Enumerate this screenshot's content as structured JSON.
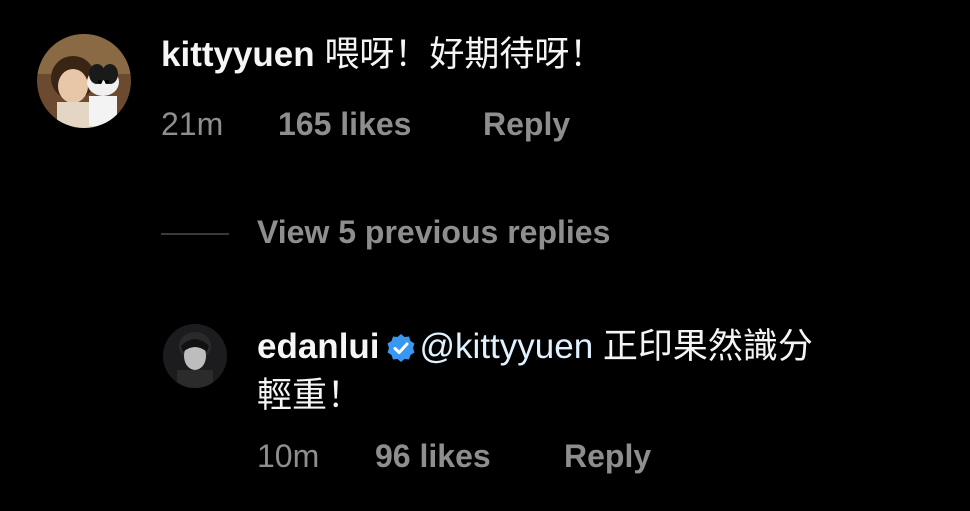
{
  "comment": {
    "username": "kittyyuen",
    "text": "喂呀！好期待呀！",
    "time": "21m",
    "likes": "165 likes",
    "reply_label": "Reply"
  },
  "view_replies_label": "View 5 previous replies",
  "reply": {
    "username": "edanlui",
    "verified": true,
    "mention": "@kittyyuen",
    "text_line1": "正印果然識分",
    "text_line2": "輕重！",
    "time": "10m",
    "likes": "96 likes",
    "reply_label": "Reply"
  },
  "colors": {
    "background": "#000000",
    "primary_text": "#f5f5f5",
    "secondary_text": "#8e8e8e",
    "verified_badge": "#3897f0",
    "mention": "#e0f1ff"
  }
}
